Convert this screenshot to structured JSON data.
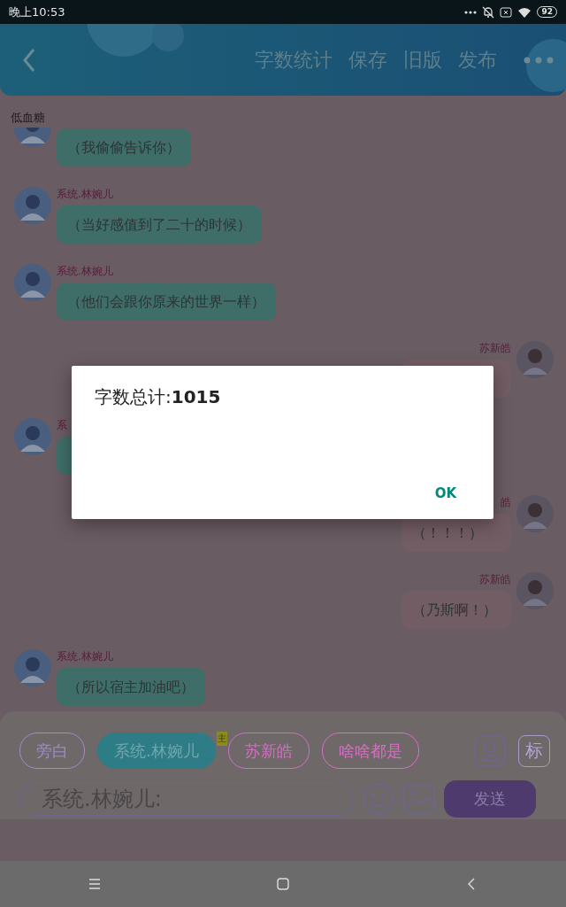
{
  "status_bar": {
    "time": "晚上10:53",
    "battery": "92"
  },
  "header": {
    "actions": [
      "字数统计",
      "保存",
      "旧版",
      "发布"
    ]
  },
  "chat": {
    "title": "低血糖",
    "messages": [
      {
        "kind": "incoming",
        "lines": [
          "（我偷偷告诉你）"
        ]
      },
      {
        "kind": "incoming",
        "name": "系统.林婉儿",
        "lines": [
          "（当好感值到了二十的时候）"
        ]
      },
      {
        "kind": "incoming",
        "name": "系统.林婉儿",
        "lines": [
          "（他们会跟你原来的世界一样）"
        ]
      },
      {
        "kind": "outgoing",
        "name": "苏新皓"
      },
      {
        "kind": "incoming",
        "name": "系"
      },
      {
        "kind": "outgoing",
        "name": "皓",
        "lines": [
          "（！！！）"
        ]
      },
      {
        "kind": "outgoing",
        "name": "苏新皓",
        "lines": [
          "（乃斯啊！）"
        ]
      },
      {
        "kind": "incoming",
        "name": "系统.林婉儿",
        "lines": [
          "（所以宿主加油吧）"
        ]
      }
    ]
  },
  "composer": {
    "roles": [
      {
        "label": "旁白",
        "selected": false,
        "color": "#a08cc8"
      },
      {
        "label": "系统.林婉儿",
        "selected": true,
        "color": "#2e7d86",
        "badge": "主"
      },
      {
        "label": "苏新皓",
        "selected": false,
        "color": "#d070c0"
      },
      {
        "label": "啥啥都是",
        "selected": false,
        "color": "#dc6cc8"
      }
    ],
    "tag_button": "标",
    "input": {
      "value": "系统.林婉儿:"
    },
    "send": "发送"
  },
  "dialog": {
    "message": "字数总计:**1015**",
    "button": "OK"
  }
}
